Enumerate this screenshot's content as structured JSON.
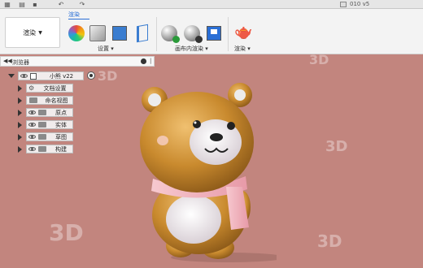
{
  "titlebar": {
    "filename": "010 v5"
  },
  "ribbon": {
    "workspace_label": "渲染",
    "active_tab": "渲染",
    "groups": [
      {
        "label": "设置"
      },
      {
        "label": "画布内渲染"
      },
      {
        "label": "渲染"
      }
    ]
  },
  "browser": {
    "title": "浏览器",
    "root": {
      "label": "小熊 v22"
    },
    "items": [
      {
        "label": "文档设置",
        "icon": "gear-icon"
      },
      {
        "label": "命名视图",
        "icon": "folder-icon"
      },
      {
        "label": "原点",
        "icon": "folder-icon"
      },
      {
        "label": "实体",
        "icon": "folder-icon"
      },
      {
        "label": "草图",
        "icon": "folder-icon"
      },
      {
        "label": "构建",
        "icon": "folder-icon"
      }
    ]
  },
  "colors": {
    "viewport_bg": "#c2857e",
    "accent": "#2a6fd6",
    "bear_body": "#c98a2e",
    "scarf": "#f1b6c0"
  }
}
